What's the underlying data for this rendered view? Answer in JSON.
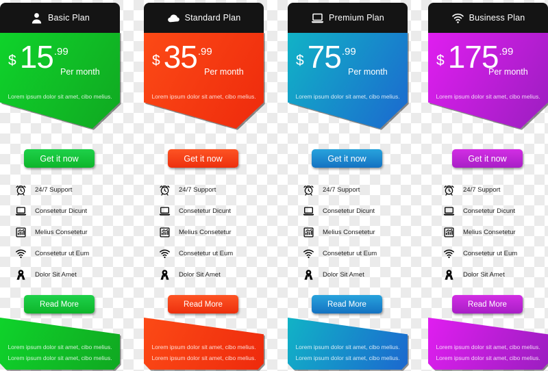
{
  "page": {
    "title": "Pricing Table",
    "background": "transparent-checkerboard"
  },
  "shared": {
    "currency_symbol": "$",
    "cents": ".99",
    "per_month_label": "Per month",
    "price_note": "Lorem ipsum dolor sit amet, cibo melius.",
    "cta_label": "Get it now",
    "read_more_label": "Read More",
    "footer_line_1": "Lorem ipsum dolor sit amet, cibo melius.",
    "footer_line_2": "Lorem ipsum dolor sit amet, cibo melius.",
    "header_background": "#141414",
    "features": [
      {
        "icon": "alarm-clock-icon",
        "label": "24/7 Support"
      },
      {
        "icon": "laptop-icon",
        "label": "Consetetur Dicunt"
      },
      {
        "icon": "bar-chart-icon",
        "label": "Melius Consetetur"
      },
      {
        "icon": "wifi-icon",
        "label": "Consetetur ut Eum"
      },
      {
        "icon": "location-pin-icon",
        "label": "Dolor Sit Amet"
      }
    ]
  },
  "plans": [
    {
      "id": "basic",
      "name": "Basic Plan",
      "header_icon": "user-icon",
      "price_amount": "15",
      "cents": ".99",
      "currency_symbol": "$",
      "per_month_label": "Per month",
      "price_note": "Lorem ipsum dolor sit amet, cibo melius.",
      "cta_label": "Get it now",
      "read_more_label": "Read More",
      "footer_line_1": "Lorem ipsum dolor sit amet, cibo melius.",
      "footer_line_2": "Lorem ipsum dolor sit amet, cibo melius.",
      "accent": "#14c728",
      "gradient_from": "#0fd32b",
      "gradient_to": "#10a821",
      "button_from": "#1ed14a",
      "button_to": "#0db52a"
    },
    {
      "id": "standard",
      "name": "Standard Plan",
      "header_icon": "cloud-icon",
      "price_amount": "35",
      "cents": ".99",
      "currency_symbol": "$",
      "per_month_label": "Per month",
      "price_note": "Lorem ipsum dolor sit amet, cibo melius.",
      "cta_label": "Get it now",
      "read_more_label": "Read More",
      "footer_line_1": "Lorem ipsum dolor sit amet, cibo melius.",
      "footer_line_2": "Lorem ipsum dolor sit amet, cibo melius.",
      "accent": "#fa3c12",
      "gradient_from": "#fc4a16",
      "gradient_to": "#ee2a0c",
      "button_from": "#fd5424",
      "button_to": "#ed300d"
    },
    {
      "id": "premium",
      "name": "Premium Plan",
      "header_icon": "laptop-icon",
      "price_amount": "75",
      "cents": ".99",
      "currency_symbol": "$",
      "per_month_label": "Per month",
      "price_note": "Lorem ipsum dolor sit amet, cibo melius.",
      "cta_label": "Get it now",
      "read_more_label": "Read More",
      "footer_line_1": "Lorem ipsum dolor sit amet, cibo melius.",
      "footer_line_2": "Lorem ipsum dolor sit amet, cibo melius.",
      "accent": "#1a8fd0",
      "gradient_from": "#11b3c6",
      "gradient_to": "#1c68cf",
      "button_from": "#28a3dd",
      "button_to": "#1472c2"
    },
    {
      "id": "business",
      "name": "Business Plan",
      "header_icon": "wifi-icon",
      "price_amount": "175",
      "cents": ".99",
      "currency_symbol": "$",
      "per_month_label": "Per month",
      "price_note": "Lorem ipsum dolor sit amet, cibo melius.",
      "cta_label": "Get it now",
      "read_more_label": "Read More",
      "footer_line_1": "Lorem ipsum dolor sit amet, cibo melius.",
      "footer_line_2": "Lorem ipsum dolor sit amet, cibo melius.",
      "accent": "#c31bd4",
      "gradient_from": "#e01ef0",
      "gradient_to": "#9b1ec0",
      "button_from": "#d22ee4",
      "button_to": "#a81fc6"
    }
  ]
}
